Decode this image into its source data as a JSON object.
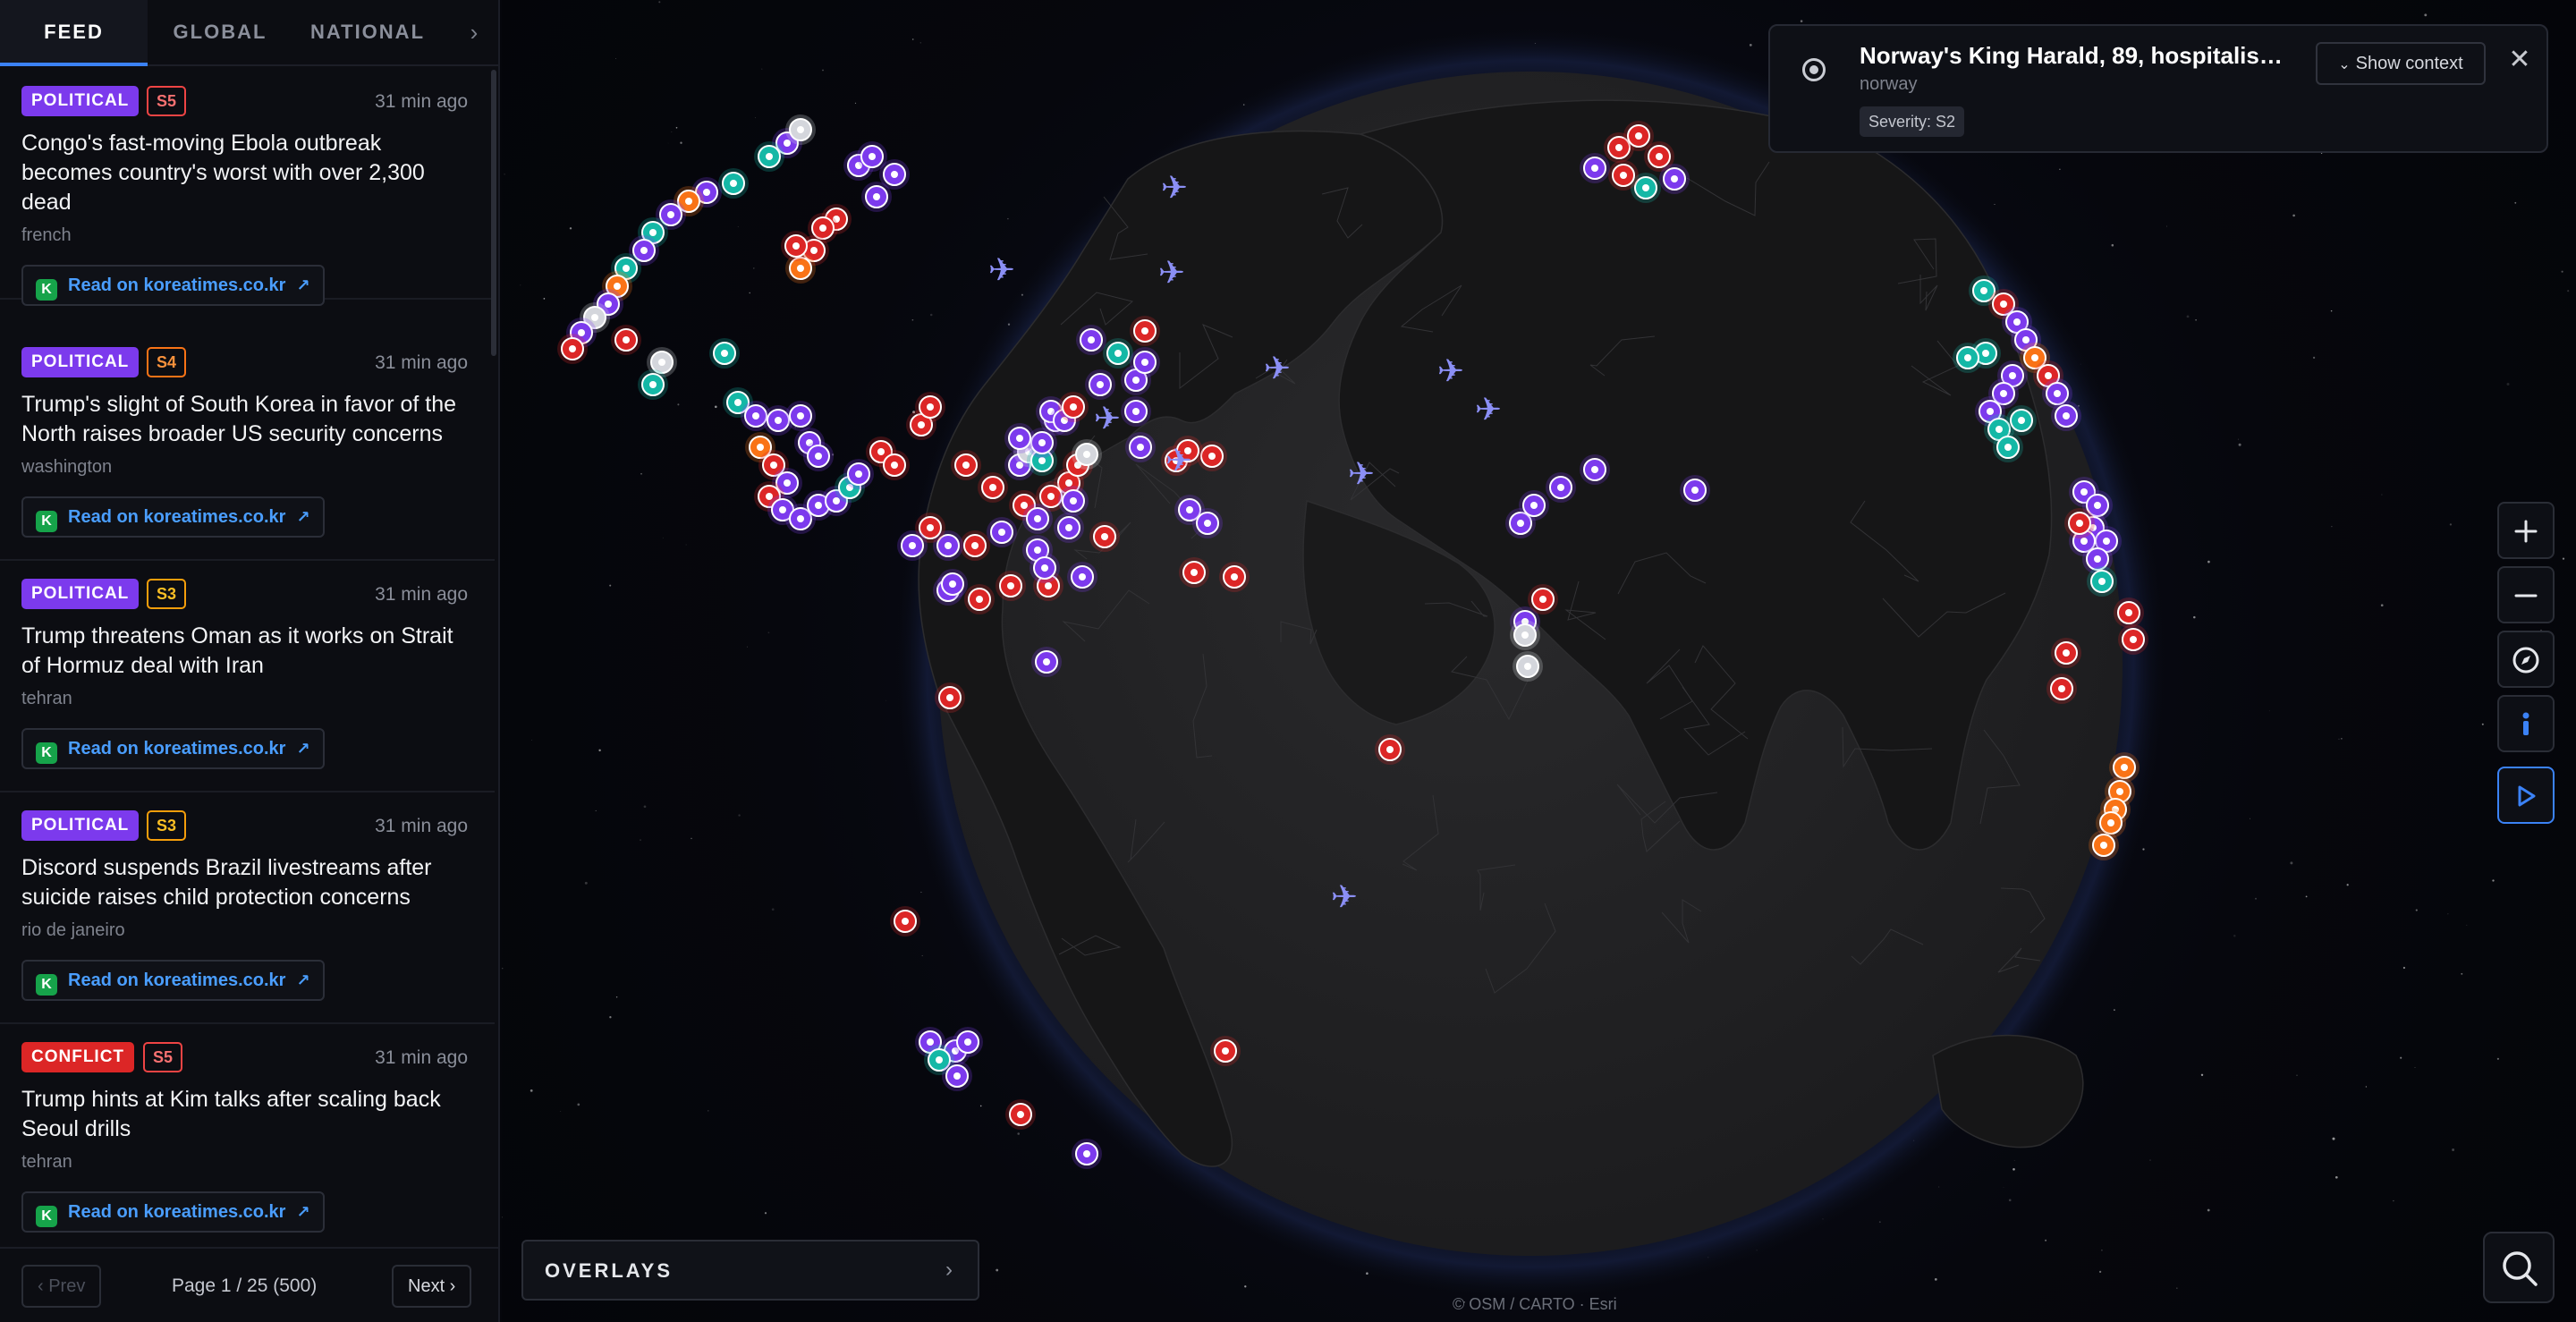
{
  "tabs": [
    {
      "label": "FEED",
      "active": true
    },
    {
      "label": "GLOBAL",
      "active": false
    },
    {
      "label": "NATIONAL",
      "active": false
    }
  ],
  "feed": {
    "items": [
      {
        "category": "POLITICAL",
        "severity": "S5",
        "time": "31 min ago",
        "headline": "Congo's fast-moving Ebola outbreak becomes country's worst with over 2,300 dead",
        "location": "french",
        "link": "Read on koreatimes.co.kr",
        "source_initial": "K"
      },
      {
        "category": "POLITICAL",
        "severity": "S4",
        "time": "31 min ago",
        "headline": "Trump's slight of South Korea in favor of the North raises broader US security concerns",
        "location": "washington",
        "link": "Read on koreatimes.co.kr",
        "source_initial": "K"
      },
      {
        "category": "POLITICAL",
        "severity": "S3",
        "time": "31 min ago",
        "headline": "Trump threatens Oman as it works on Strait of Hormuz deal with Iran",
        "location": "tehran",
        "link": "Read on koreatimes.co.kr",
        "source_initial": "K"
      },
      {
        "category": "POLITICAL",
        "severity": "S3",
        "time": "31 min ago",
        "headline": "Discord suspends Brazil livestreams after suicide raises child protection concerns",
        "location": "rio de janeiro",
        "link": "Read on koreatimes.co.kr",
        "source_initial": "K"
      },
      {
        "category": "CONFLICT",
        "severity": "S5",
        "time": "31 min ago",
        "headline": "Trump hints at Kim talks after scaling back Seoul drills",
        "location": "tehran",
        "link": "Read on koreatimes.co.kr",
        "source_initial": "K"
      }
    ]
  },
  "pager": {
    "prev": "‹ Prev",
    "info": "Page 1 / 25 (500)",
    "next": "Next ›"
  },
  "notice": {
    "title": "Norway's King Harald, 89, hospitalised…",
    "location": "norway",
    "severity": "Severity: S2",
    "context_button": "Show context",
    "close": "✕"
  },
  "overlays": {
    "label": "OVERLAYS"
  },
  "attribution": "© OSM / CARTO · Esri",
  "controls": [
    "zoom-in",
    "zoom-out",
    "compass",
    "info",
    "play",
    "search"
  ],
  "colors": {
    "accent": "#3b82f6",
    "political": "#7c3aed",
    "conflict": "#dc2626",
    "economic": "#14b8a6",
    "fire": "#f97316",
    "aviation": "#8b8ff5"
  }
}
